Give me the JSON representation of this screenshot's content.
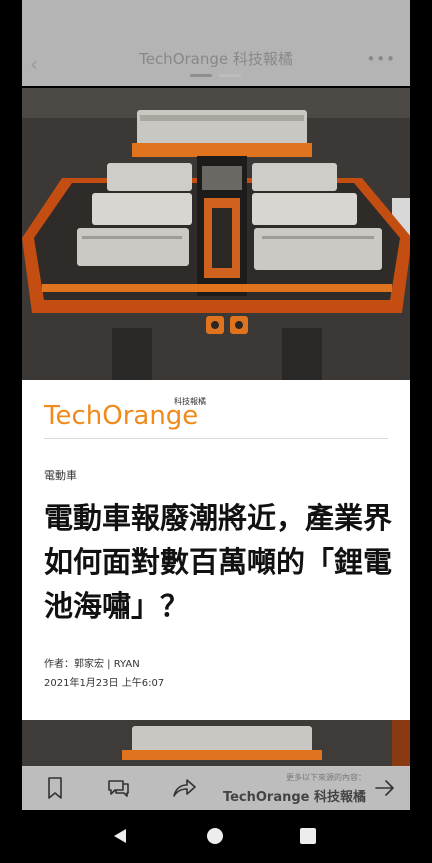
{
  "header": {
    "title": "TechOrange 科技報橘",
    "back_icon": "chevron-left-icon",
    "more_icon": "more-dots-icon"
  },
  "article": {
    "logo_text": "TechOrange",
    "logo_tagline": "科技報橘",
    "category": "電動車",
    "title": "電動車報廢潮將近，產業界如何面對數百萬噸的「鋰電池海嘯」？",
    "author": "作者：郭家宏 | RYAN",
    "date": "2021年1月23日 上午6:07"
  },
  "footer": {
    "bookmark_icon": "bookmark-icon",
    "comment_icon": "comment-icon",
    "share_icon": "share-icon",
    "more_label": "更多以下來源的內容：",
    "source_name": "TechOrange 科技報橘",
    "arrow_icon": "arrow-right-icon"
  },
  "system_nav": {
    "back": "back-triangle-icon",
    "home": "home-circle-icon",
    "recents": "recents-square-icon"
  },
  "colors": {
    "brand_orange": "#f08a1c",
    "text_dark": "#111111",
    "bar_gray": "#cdcdcd"
  }
}
